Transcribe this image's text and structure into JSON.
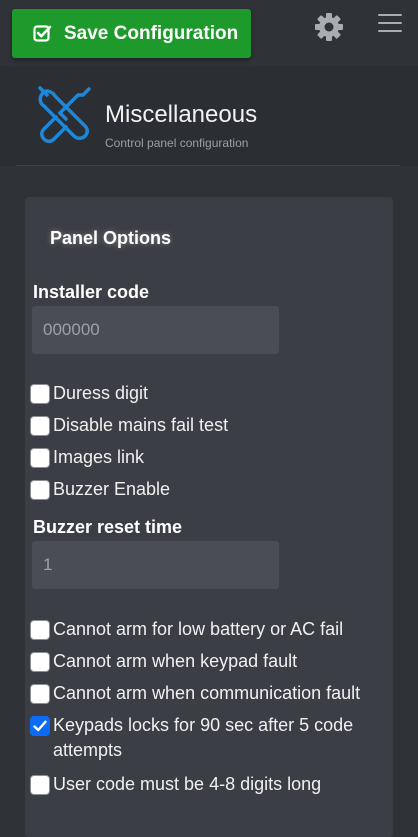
{
  "toolbar": {
    "save_label": "Save Configuration"
  },
  "header": {
    "title": "Miscellaneous",
    "subtitle": "Control panel configuration"
  },
  "panel": {
    "title": "Panel Options",
    "installer_code": {
      "label": "Installer code",
      "placeholder": "000000"
    },
    "buzzer_reset": {
      "label": "Buzzer reset time",
      "placeholder": "1"
    },
    "options_a": [
      {
        "label": "Duress digit",
        "checked": false
      },
      {
        "label": "Disable mains fail test",
        "checked": false
      },
      {
        "label": "Images link",
        "checked": false
      },
      {
        "label": "Buzzer Enable",
        "checked": false
      }
    ],
    "options_b": [
      {
        "label": "Cannot arm for low battery or AC fail",
        "checked": false
      },
      {
        "label": "Cannot arm when keypad fault",
        "checked": false
      },
      {
        "label": "Cannot arm when communication fault",
        "checked": false
      },
      {
        "label": "Keypads locks for 90 sec after 5 code attempts",
        "checked": true
      },
      {
        "label": "User code must be 4-8 digits long",
        "checked": false
      }
    ]
  },
  "colors": {
    "save_green": "#1d9a2b",
    "accent_blue": "#0a6cf5",
    "icon_blue": "#1e88d8",
    "background": "#2f3237",
    "panel": "#3b3e44"
  }
}
